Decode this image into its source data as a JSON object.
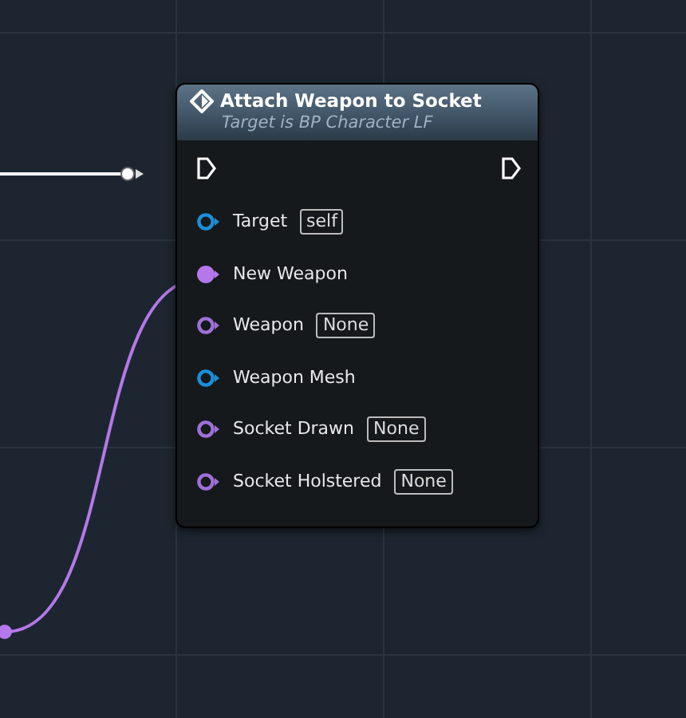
{
  "node": {
    "title": "Attach Weapon to Socket",
    "subtitle": "Target is BP Character LF",
    "exec": {
      "input_connected": false,
      "output_connected": false
    },
    "pins": [
      {
        "label": "Target",
        "color": "#1b8fd8",
        "connected": false,
        "value": "self"
      },
      {
        "label": "New Weapon",
        "color": "#b478ea",
        "connected": true
      },
      {
        "label": "Weapon",
        "color": "#a070d8",
        "connected": false,
        "value": "None"
      },
      {
        "label": "Weapon Mesh",
        "color": "#1b8fd8",
        "connected": false
      },
      {
        "label": "Socket Drawn",
        "color": "#a070d8",
        "connected": false,
        "value": "None"
      },
      {
        "label": "Socket Holstered",
        "color": "#a070d8",
        "connected": false,
        "value": "None"
      }
    ]
  }
}
